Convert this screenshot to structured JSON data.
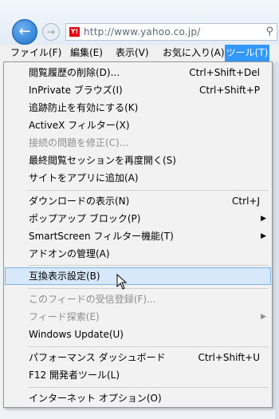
{
  "address_bar": {
    "url": "http://www.yahoo.co.jp/",
    "favicon_text": "Y!"
  },
  "menubar": [
    "ファイル(F)",
    "編集(E)",
    "表示(V)",
    "お気に入り(A)",
    "ツール(T)"
  ],
  "tools_menu": [
    {
      "label": "閲覧履歴の削除(D)...",
      "shortcut": "Ctrl+Shift+Del"
    },
    {
      "label": "InPrivate ブラウズ(I)",
      "shortcut": "Ctrl+Shift+P"
    },
    {
      "label": "追跡防止を有効にする(K)"
    },
    {
      "label": "ActiveX フィルター(X)"
    },
    {
      "label": "接続の問題を修正(C)...",
      "disabled": true
    },
    {
      "label": "最終閲覧セッションを再度開く(S)"
    },
    {
      "label": "サイトをアプリに追加(A)"
    },
    {
      "label": "ダウンロードの表示(N)",
      "shortcut": "Ctrl+J"
    },
    {
      "label": "ポップアップ ブロック(P)",
      "submenu": true
    },
    {
      "label": "SmartScreen フィルター機能(T)",
      "submenu": true
    },
    {
      "label": "アドオンの管理(A)"
    },
    {
      "label": "互換表示設定(B)",
      "hover": true
    },
    {
      "label": "このフィードの受信登録(F)...",
      "disabled": true
    },
    {
      "label": "フィード探索(E)",
      "disabled": true,
      "submenu": true
    },
    {
      "label": "Windows Update(U)"
    },
    {
      "label": "パフォーマンス ダッシュボード",
      "shortcut": "Ctrl+Shift+U"
    },
    {
      "label": "F12 開発者ツール(L)"
    },
    {
      "label": "インターネット オプション(O)"
    }
  ]
}
